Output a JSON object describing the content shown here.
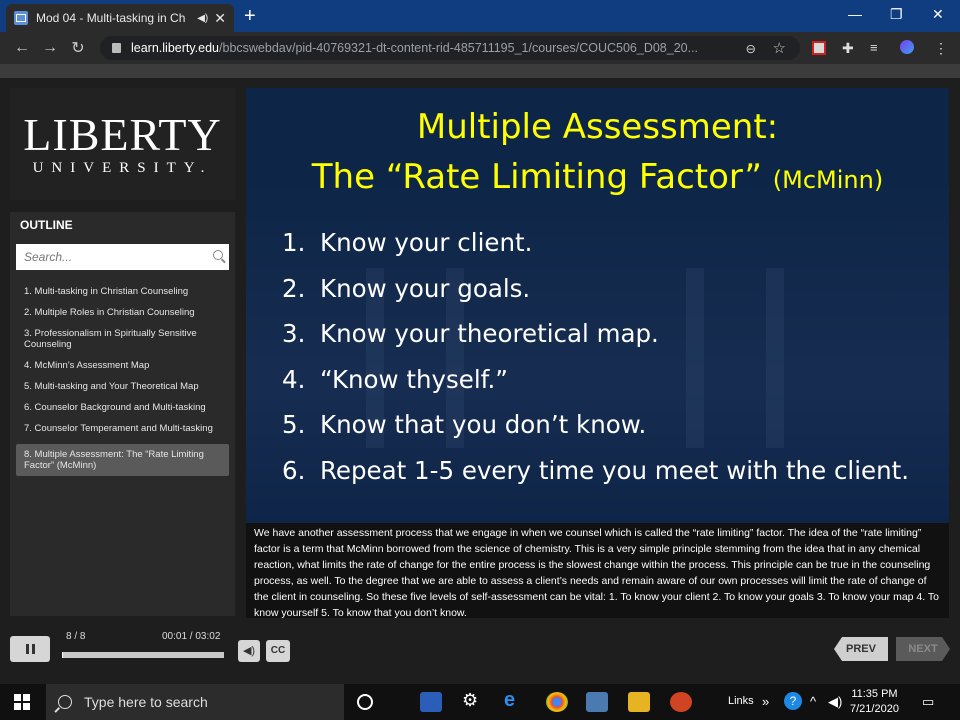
{
  "browser": {
    "tab_title": "Mod 04 - Multi-tasking in Ch",
    "url_host": "learn.liberty.edu",
    "url_path": "/bbcswebdav/pid-40769321-dt-content-rid-485711195_1/courses/COUC506_D08_20..."
  },
  "logo": {
    "main": "LIBERTY",
    "sub": "UNIVERSITY."
  },
  "outline": {
    "title": "OUTLINE",
    "search_placeholder": "Search...",
    "items": [
      "1. Multi-tasking in Christian Counseling",
      "2. Multiple Roles in Christian Counseling",
      "3. Professionalism in Spiritually Sensitive Counseling",
      "4. McMinn's Assessment Map",
      "5. Multi-tasking and Your Theoretical Map",
      "6. Counselor Background and Multi-tasking",
      "7. Counselor Temperament and Multi-tasking",
      "8. Multiple Assessment: The “Rate Limiting Factor” (McMinn)"
    ]
  },
  "slide": {
    "title_line1": "Multiple Assessment:",
    "title_line2": "The “Rate Limiting Factor”",
    "title_cite": "(McMinn)",
    "steps": [
      {
        "num": "1.",
        "text": "Know your client."
      },
      {
        "num": "2.",
        "text": "Know your goals."
      },
      {
        "num": "3.",
        "text": "Know your theoretical map."
      },
      {
        "num": "4.",
        "text": "“Know thyself.”"
      },
      {
        "num": "5.",
        "text": "Know that you don’t know."
      },
      {
        "num": "6.",
        "text": "Repeat 1-5 every time you meet with the client."
      }
    ],
    "transcript": "We have another assessment process that we engage in when we counsel which is called the “rate limiting” factor. The idea of the “rate limiting” factor is a term that McMinn borrowed from the science of chemistry. This is a very simple principle stemming from the idea that in any chemical reaction, what limits the rate of change for the entire process is the slowest change within the process. This principle can be true in the counseling process, as well. To the degree that we are able to assess a client’s needs and remain aware of our own processes will limit the rate of change of the client in counseling. So these five levels of self-assessment can be vital: 1. To know your client 2. To know your goals 3. To know your map 4. To know yourself 5. To know that you don’t know."
  },
  "controls": {
    "slide_count": "8 / 8",
    "time": "00:01 / 03:02",
    "progress_fraction": 0.005,
    "cc_label": "CC",
    "prev_label": "PREV",
    "next_label": "NEXT"
  },
  "taskbar": {
    "search_placeholder": "Type here to search",
    "links_label": "Links",
    "time": "11:35 PM",
    "date": "7/21/2020"
  }
}
